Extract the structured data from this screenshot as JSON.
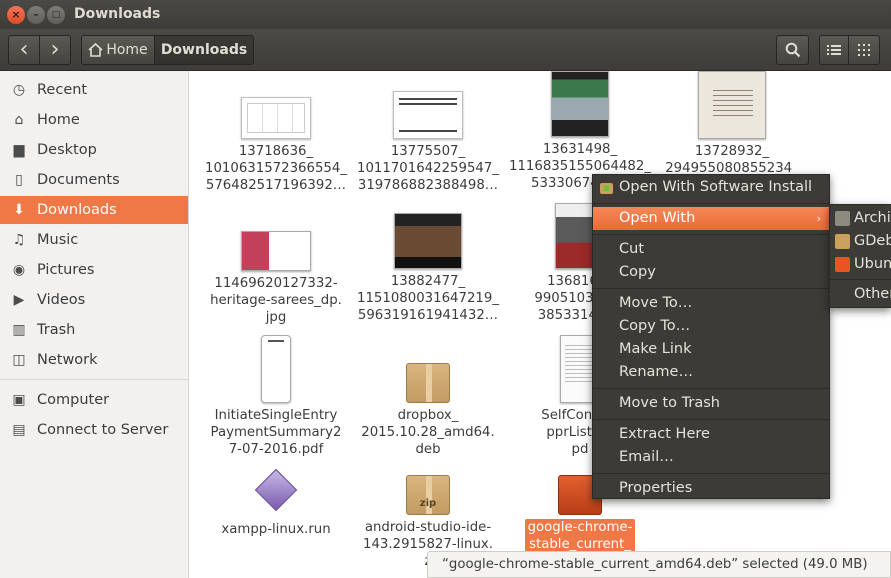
{
  "window": {
    "title": "Downloads",
    "close_glyph": "×",
    "minimize_glyph": "–",
    "maximize_glyph": "□"
  },
  "toolbar": {
    "back_icon": "‹",
    "forward_icon": "›",
    "breadcrumb": [
      {
        "label": "Home",
        "icon": "home-icon"
      },
      {
        "label": "Downloads"
      }
    ]
  },
  "sidebar": {
    "items": [
      {
        "label": "Recent",
        "icon": "clock-icon",
        "glyph": "◷"
      },
      {
        "label": "Home",
        "icon": "home-icon",
        "glyph": "⌂"
      },
      {
        "label": "Desktop",
        "icon": "folder-icon",
        "glyph": "▆"
      },
      {
        "label": "Documents",
        "icon": "document-icon",
        "glyph": "▯"
      },
      {
        "label": "Downloads",
        "icon": "download-icon",
        "glyph": "⬇",
        "active": true
      },
      {
        "label": "Music",
        "icon": "music-icon",
        "glyph": "♫"
      },
      {
        "label": "Pictures",
        "icon": "camera-icon",
        "glyph": "◉"
      },
      {
        "label": "Videos",
        "icon": "video-icon",
        "glyph": "▶"
      },
      {
        "label": "Trash",
        "icon": "trash-icon",
        "glyph": "▥"
      },
      {
        "label": "Network",
        "icon": "network-icon",
        "glyph": "◫"
      },
      {
        "label": "Computer",
        "icon": "computer-icon",
        "glyph": "▣"
      },
      {
        "label": "Connect to Server",
        "icon": "server-icon",
        "glyph": "▤"
      }
    ]
  },
  "files": [
    {
      "name": "13718636_\n1010631572366554_\n576482517196392…",
      "thumb": "meme"
    },
    {
      "name": "13775507_\n1011701642259547_\n319786882388498…",
      "thumb": "meme-text"
    },
    {
      "name": "13631498_\n1116835155064482_\n5333067497…",
      "thumb": "car"
    },
    {
      "name": "13728932_\n294955080855234_",
      "thumb": "quote"
    },
    {
      "name": "11469620127332-\nheritage-sarees_dp.\njpg",
      "thumb": "sarees"
    },
    {
      "name": "13882477_\n1151080031647219_\n596319161941432…",
      "thumb": "face"
    },
    {
      "name": "1368164_\n9905103077_\n3853314224",
      "thumb": "bike"
    },
    {
      "name": "InitiateSingleEntry\nPaymentSummary2\n7-07-2016.pdf",
      "thumb": "pdf"
    },
    {
      "name": "dropbox_\n2015.10.28_amd64.\ndeb",
      "thumb": "box"
    },
    {
      "name": "SelfConfirm\npprList27-\npd",
      "thumb": "doc"
    },
    {
      "name": "xampp-linux.run",
      "thumb": "diamond"
    },
    {
      "name": "android-studio-ide-\n143.2915827-linux.\nz",
      "thumb": "zip"
    },
    {
      "name": "google-chrome-\nstable_current_",
      "thumb": "deb",
      "selected": true
    }
  ],
  "zip_label": "zip",
  "context_menu": {
    "items": [
      {
        "label": "Open With Software Install",
        "icon": "software-install-icon"
      },
      {
        "label": "Open With",
        "submenu": true,
        "highlighted": true
      },
      {
        "label": "Cut"
      },
      {
        "label": "Copy"
      },
      {
        "label": "Move To…"
      },
      {
        "label": "Copy To…"
      },
      {
        "label": "Make Link"
      },
      {
        "label": "Rename…"
      },
      {
        "label": "Move to Trash"
      },
      {
        "label": "Extract Here"
      },
      {
        "label": "Email…"
      },
      {
        "label": "Properties"
      }
    ],
    "submenu_arrow": "›"
  },
  "submenu": {
    "items": [
      {
        "label": "Archive Manager",
        "icon": "archive-manager-icon"
      },
      {
        "label": "GDebi Package Installer",
        "icon": "gdebi-icon"
      },
      {
        "label": "Ubuntu Software",
        "icon": "ubuntu-software-icon"
      },
      {
        "label": "Other Application…"
      }
    ]
  },
  "status": {
    "text": "“google-chrome-stable_current_amd64.deb” selected  (49.0 MB)"
  },
  "colors": {
    "accent": "#f07746",
    "menu_bg": "#3c3b37",
    "titlebar": "#3d3c38"
  }
}
